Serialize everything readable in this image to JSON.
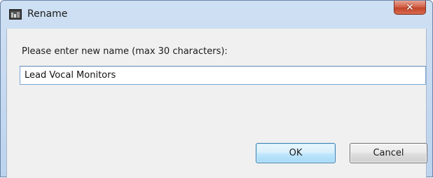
{
  "window": {
    "title": "Rename",
    "close_glyph": "✕",
    "app_icon": "app-window-icon"
  },
  "dialog": {
    "prompt": "Please enter new name (max 30 characters):",
    "input_value": "Lead Vocal Monitors",
    "ok_label": "OK",
    "cancel_label": "Cancel"
  },
  "colors": {
    "titlebar": "#c4d8ef",
    "client_bg": "#f0f0f0",
    "close_button": "#c9533a",
    "default_button_border": "#3c7fb1"
  }
}
